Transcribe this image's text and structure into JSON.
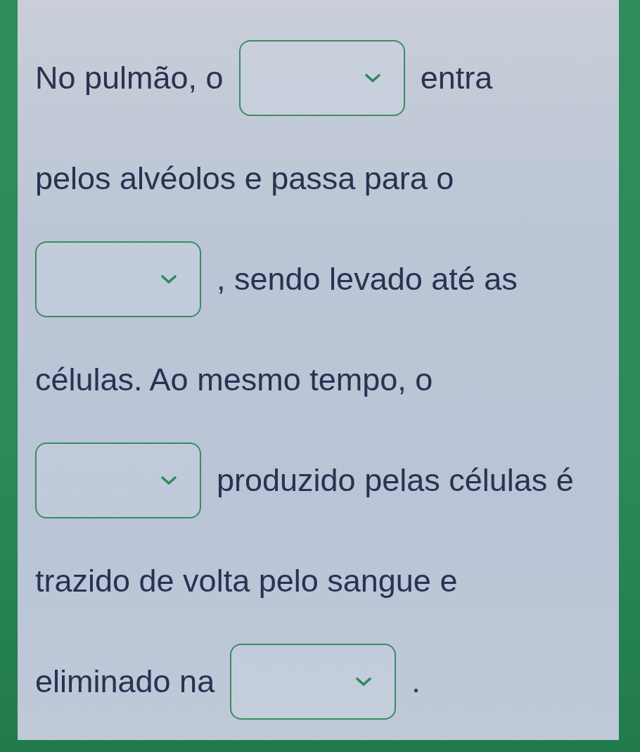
{
  "lines": [
    {
      "parts": [
        {
          "kind": "text",
          "text": "No pulmão, o"
        },
        {
          "kind": "dropdown"
        },
        {
          "kind": "text",
          "text": "entra"
        }
      ]
    },
    {
      "parts": [
        {
          "kind": "text",
          "text": "pelos alvéolos e passa para o"
        }
      ]
    },
    {
      "parts": [
        {
          "kind": "dropdown"
        },
        {
          "kind": "text",
          "text": ", sendo levado até as"
        }
      ]
    },
    {
      "parts": [
        {
          "kind": "text",
          "text": "células. Ao mesmo tempo, o"
        }
      ]
    },
    {
      "parts": [
        {
          "kind": "dropdown"
        },
        {
          "kind": "text",
          "text": "produzido pelas células é"
        }
      ]
    },
    {
      "parts": [
        {
          "kind": "text",
          "text": "trazido de volta pelo sangue e"
        }
      ]
    },
    {
      "parts": [
        {
          "kind": "text",
          "text": "eliminado na"
        },
        {
          "kind": "dropdown"
        },
        {
          "kind": "text",
          "text": "."
        }
      ]
    }
  ]
}
